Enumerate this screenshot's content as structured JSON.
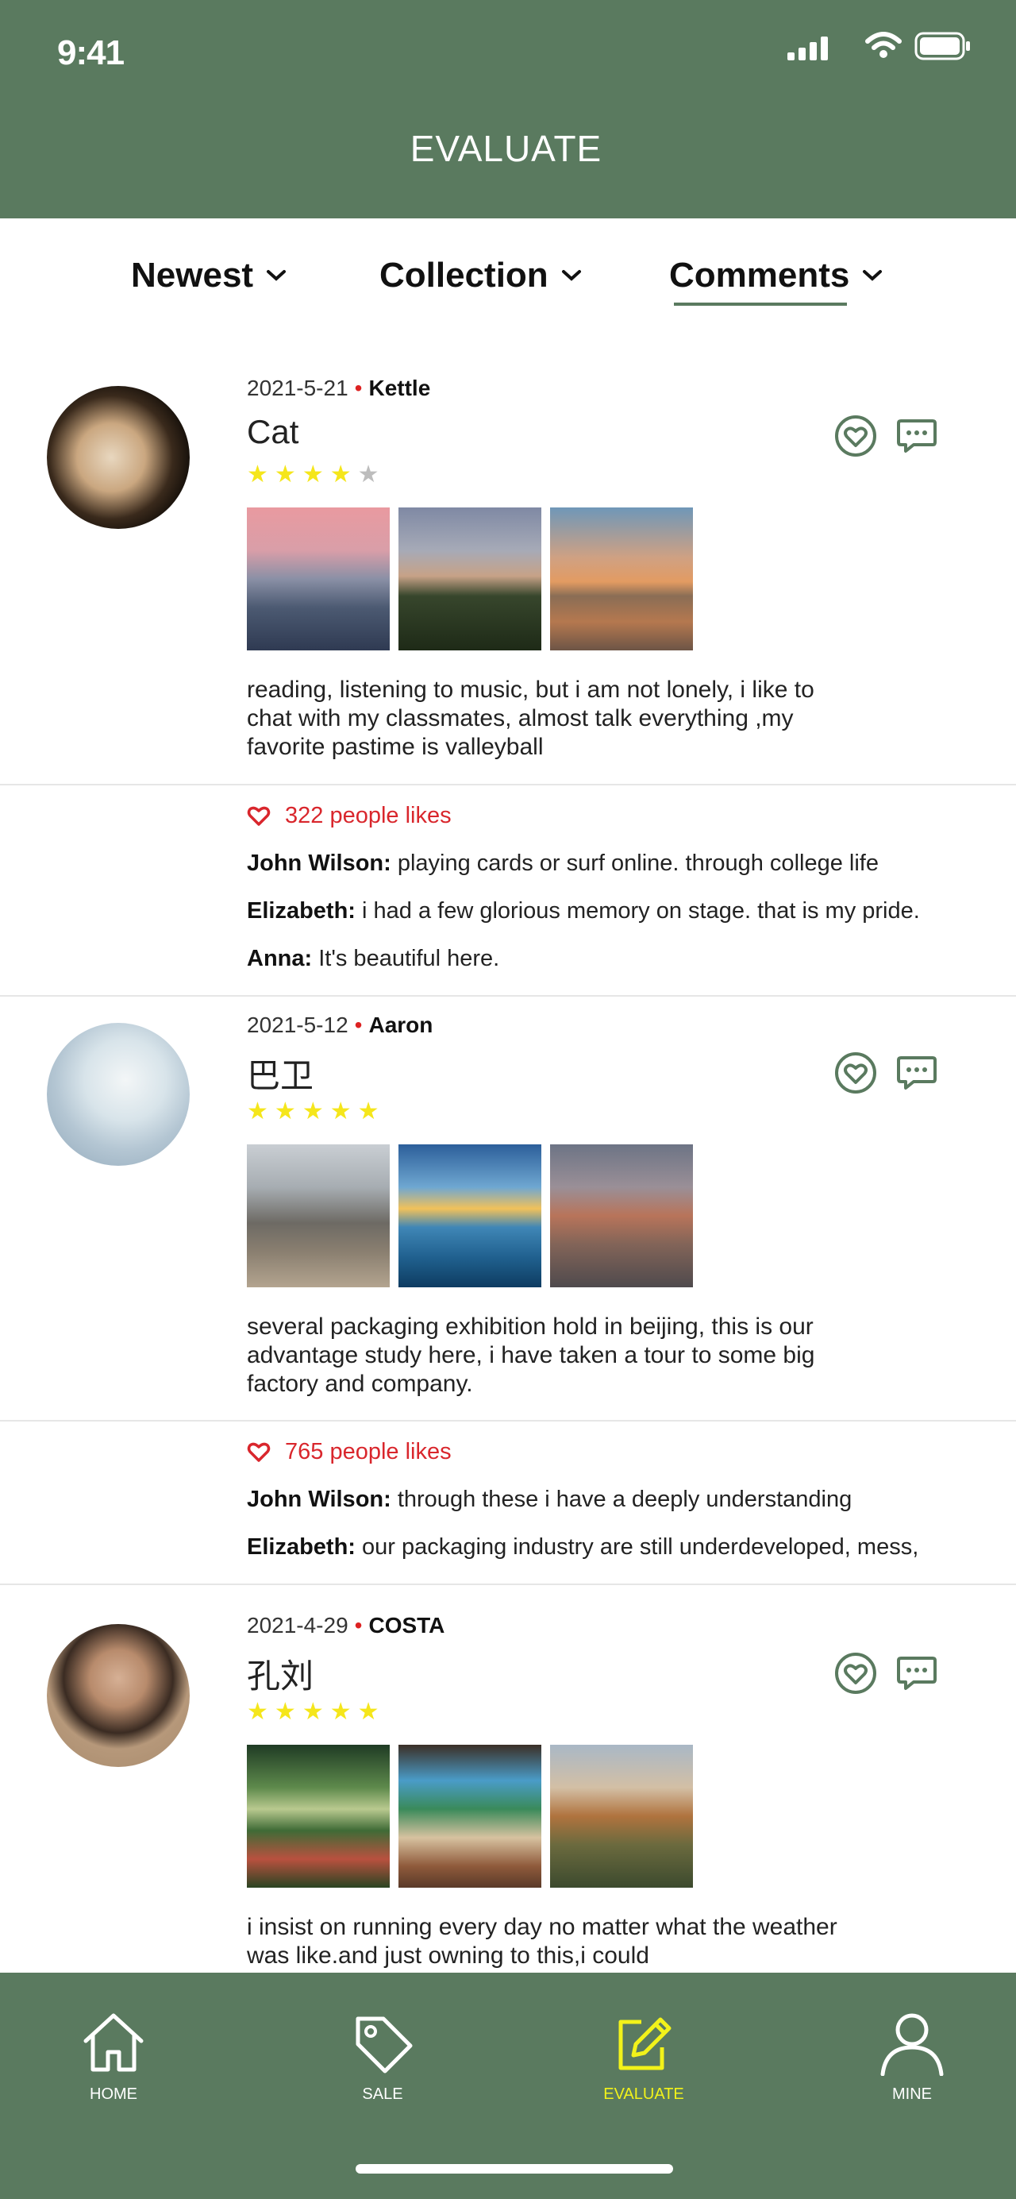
{
  "status_bar": {
    "time": "9:41"
  },
  "header": {
    "title": "EVALUATE"
  },
  "tabs": [
    {
      "label": "Newest"
    },
    {
      "label": "Collection"
    },
    {
      "label": "Comments",
      "active": true
    }
  ],
  "posts": [
    {
      "date": "2021-5-21",
      "author": "Kettle",
      "title": "Cat",
      "rating": 4,
      "max_rating": 5,
      "text": "reading, listening to music, but i am not lonely, i like to chat with my classmates, almost talk everything ,my favorite pastime is valleyball",
      "likes": "322 people likes",
      "comments": [
        {
          "name": "John Wilson:",
          "text": " playing cards or surf online. through college life"
        },
        {
          "name": "Elizabeth:",
          "text": "  i had a few glorious memory on stage. that is my pride."
        },
        {
          "name": "Anna:",
          "text": " It's beautiful here."
        }
      ]
    },
    {
      "date": "2021-5-12",
      "author": "Aaron",
      "title": "巴卫",
      "rating": 5,
      "max_rating": 5,
      "text": "several packaging exhibition hold in beijing, this is our advantage study here, i have taken a tour to some big factory and company.",
      "likes": "765 people likes",
      "comments": [
        {
          "name": "John Wilson:",
          "text": " through these i have a deeply understanding"
        },
        {
          "name": "Elizabeth:",
          "text": " our packaging industry are still underdeveloped, mess,"
        }
      ]
    },
    {
      "date": "2021-4-29",
      "author": "COSTA",
      "title": "孔刘",
      "rating": 5,
      "max_rating": 5,
      "text": "i insist on running every day no matter what the weather was like.and just owning to this,i could"
    }
  ],
  "tabbar": [
    {
      "label": "HOME",
      "icon": "home-icon"
    },
    {
      "label": "SALE",
      "icon": "tag-icon"
    },
    {
      "label": "EVALUATE",
      "icon": "edit-icon",
      "active": true
    },
    {
      "label": "MINE",
      "icon": "user-icon"
    }
  ],
  "colors": {
    "brand_green": "#5a7a5f",
    "active_tab": "#f2f21a",
    "star_yellow": "#f5e61b",
    "star_gray": "#bdbdbd",
    "like_red": "#d9262c"
  }
}
